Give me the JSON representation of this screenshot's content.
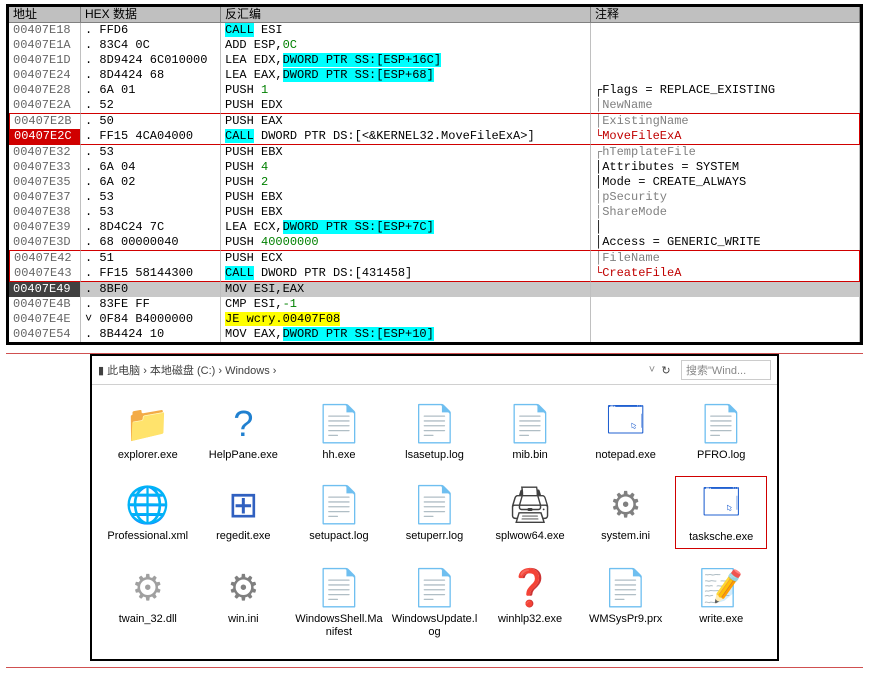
{
  "disasm": {
    "headers": {
      "addr": "地址",
      "hex": "HEX 数据",
      "dis": "反汇编",
      "cmt": "注释"
    },
    "rows": [
      {
        "addr": "00407E18",
        "dot": ".",
        "hex": "FFD6",
        "dis": [
          {
            "t": "CALL",
            "c": "hl-cyan"
          },
          {
            "t": " ESI"
          }
        ],
        "cmt": ""
      },
      {
        "addr": "00407E1A",
        "dot": ".",
        "hex": "83C4 0C",
        "dis": [
          {
            "t": "ADD ESP,"
          },
          {
            "t": "0C",
            "c": "txt-green"
          }
        ],
        "cmt": ""
      },
      {
        "addr": "00407E1D",
        "dot": ".",
        "hex": "8D9424 6C010000",
        "dis": [
          {
            "t": "LEA EDX,"
          },
          {
            "t": "DWORD PTR SS:[ESP+16C]",
            "c": "hl-cyan"
          }
        ],
        "cmt": ""
      },
      {
        "addr": "00407E24",
        "dot": ".",
        "hex": "8D4424 68",
        "dis": [
          {
            "t": "LEA EAX,"
          },
          {
            "t": "DWORD PTR SS:[ESP+68]",
            "c": "hl-cyan"
          }
        ],
        "cmt": ""
      },
      {
        "addr": "00407E28",
        "dot": ".",
        "hex": "6A 01",
        "dis": [
          {
            "t": "PUSH "
          },
          {
            "t": "1",
            "c": "txt-green"
          }
        ],
        "cmt": "┌Flags = REPLACE_EXISTING"
      },
      {
        "addr": "00407E2A",
        "dot": ".",
        "hex": "52",
        "dis": [
          {
            "t": "PUSH EDX"
          }
        ],
        "cmt": "│NewName",
        "cmtc": "txt-gray"
      },
      {
        "addr": "00407E2B",
        "dot": ".",
        "hex": "50",
        "dis": [
          {
            "t": "PUSH EAX"
          }
        ],
        "cmt": "│ExistingName",
        "cmtc": "txt-gray",
        "redtop": true
      },
      {
        "addr": "00407E2C",
        "addrc": "addr-red",
        "dot": ".",
        "hex": "FF15 4CA04000",
        "dis": [
          {
            "t": "CALL",
            "c": "hl-cyan"
          },
          {
            "t": " DWORD PTR DS:[<&KERNEL32.MoveFileExA>]"
          }
        ],
        "cmt": "└MoveFileExA",
        "cmtc": "txt-red",
        "redbot": true
      },
      {
        "addr": "00407E32",
        "dot": ".",
        "hex": "53",
        "dis": [
          {
            "t": "PUSH EBX"
          }
        ],
        "cmt": "┌hTemplateFile",
        "cmtc": "txt-gray"
      },
      {
        "addr": "00407E33",
        "dot": ".",
        "hex": "6A 04",
        "dis": [
          {
            "t": "PUSH "
          },
          {
            "t": "4",
            "c": "txt-green"
          }
        ],
        "cmt": "│Attributes = SYSTEM"
      },
      {
        "addr": "00407E35",
        "dot": ".",
        "hex": "6A 02",
        "dis": [
          {
            "t": "PUSH "
          },
          {
            "t": "2",
            "c": "txt-green"
          }
        ],
        "cmt": "│Mode = CREATE_ALWAYS"
      },
      {
        "addr": "00407E37",
        "dot": ".",
        "hex": "53",
        "dis": [
          {
            "t": "PUSH EBX"
          }
        ],
        "cmt": "│pSecurity",
        "cmtc": "txt-gray"
      },
      {
        "addr": "00407E38",
        "dot": ".",
        "hex": "53",
        "dis": [
          {
            "t": "PUSH EBX"
          }
        ],
        "cmt": "│ShareMode",
        "cmtc": "txt-gray"
      },
      {
        "addr": "00407E39",
        "dot": ".",
        "hex": "8D4C24 7C",
        "dis": [
          {
            "t": "LEA ECX,"
          },
          {
            "t": "DWORD PTR SS:[ESP+7C]",
            "c": "hl-cyan"
          }
        ],
        "cmt": "│"
      },
      {
        "addr": "00407E3D",
        "dot": ".",
        "hex": "68 00000040",
        "dis": [
          {
            "t": "PUSH "
          },
          {
            "t": "40000000",
            "c": "txt-green"
          }
        ],
        "cmt": "│Access = GENERIC_WRITE"
      },
      {
        "addr": "00407E42",
        "dot": ".",
        "hex": "51",
        "dis": [
          {
            "t": "PUSH ECX"
          }
        ],
        "cmt": "│FileName",
        "cmtc": "txt-gray",
        "redtop": true
      },
      {
        "addr": "00407E43",
        "dot": ".",
        "hex": "FF15 58144300",
        "dis": [
          {
            "t": "CALL",
            "c": "hl-cyan"
          },
          {
            "t": " DWORD PTR DS:[431458]"
          }
        ],
        "cmt": "└CreateFileA",
        "cmtc": "txt-red",
        "redbot": true
      },
      {
        "addr": "00407E49",
        "addrc": "addr-sel",
        "dot": ".",
        "hex": "8BF0",
        "dis": [
          {
            "t": "MOV ESI,EAX"
          }
        ],
        "cmt": "",
        "sel": true
      },
      {
        "addr": "00407E4B",
        "dot": ".",
        "hex": "83FE FF",
        "dis": [
          {
            "t": "CMP ESI,"
          },
          {
            "t": "-1",
            "c": "txt-green"
          }
        ],
        "cmt": ""
      },
      {
        "addr": "00407E4E",
        "dot": ".",
        "pre": "˅",
        "hex": "0F84 B4000000",
        "dis": [
          {
            "t": "JE ",
            "c": "hl-yellow"
          },
          {
            "t": "wcry.00407F08",
            "c": "hl-yellow"
          }
        ],
        "cmt": ""
      },
      {
        "addr": "00407E54",
        "dot": ".",
        "hex": "8B4424 10",
        "dis": [
          {
            "t": "MOV EAX,"
          },
          {
            "t": "DWORD PTR SS:[ESP+10]",
            "c": "hl-cyan"
          }
        ],
        "cmt": ""
      }
    ]
  },
  "explorer": {
    "breadcrumb": [
      "此电脑",
      "本地磁盘 (C:)",
      "Windows"
    ],
    "bullet": "▮",
    "arrow": "›",
    "search_placeholder": "搜索\"Wind...",
    "reload": "↻",
    "chev": "˅",
    "files": [
      {
        "name": "explorer.exe",
        "icon": "📁",
        "ic": "ic-folder"
      },
      {
        "name": "HelpPane.exe",
        "icon": "?",
        "ic": "ic-help"
      },
      {
        "name": "hh.exe",
        "icon": "📄",
        "ic": "ic-hh"
      },
      {
        "name": "lsasetup.log",
        "icon": "📄",
        "ic": "ic-doc"
      },
      {
        "name": "mib.bin",
        "icon": "📄",
        "ic": "ic-doc"
      },
      {
        "name": "notepad.exe",
        "icon": "🗔",
        "ic": "ic-notepad"
      },
      {
        "name": "PFRO.log",
        "icon": "📄",
        "ic": "ic-doc"
      },
      {
        "name": "Professional.xml",
        "icon": "🌐",
        "ic": "ic-globe"
      },
      {
        "name": "regedit.exe",
        "icon": "⊞",
        "ic": "ic-registry"
      },
      {
        "name": "setupact.log",
        "icon": "📄",
        "ic": "ic-doc"
      },
      {
        "name": "setuperr.log",
        "icon": "📄",
        "ic": "ic-doc"
      },
      {
        "name": "splwow64.exe",
        "icon": "🖨",
        "ic": "ic-printer"
      },
      {
        "name": "system.ini",
        "icon": "⚙",
        "ic": "ic-gear"
      },
      {
        "name": "tasksche.exe",
        "icon": "🗔",
        "ic": "ic-notepad",
        "hl": true
      },
      {
        "name": "twain_32.dll",
        "icon": "⚙",
        "ic": "ic-dll"
      },
      {
        "name": "win.ini",
        "icon": "⚙",
        "ic": "ic-gear"
      },
      {
        "name": "WindowsShell.Manifest",
        "icon": "📄",
        "ic": "ic-doc"
      },
      {
        "name": "WindowsUpdate.log",
        "icon": "📄",
        "ic": "ic-doc"
      },
      {
        "name": "winhlp32.exe",
        "icon": "❓",
        "ic": "ic-helpq"
      },
      {
        "name": "WMSysPr9.prx",
        "icon": "📄",
        "ic": "ic-doc"
      },
      {
        "name": "write.exe",
        "icon": "📝",
        "ic": "ic-write"
      }
    ]
  }
}
